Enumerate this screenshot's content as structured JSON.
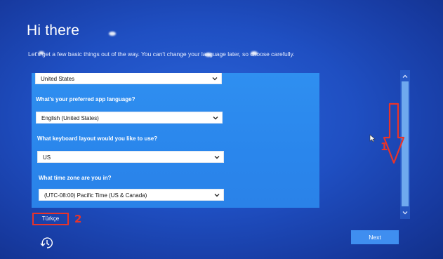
{
  "header": {
    "title": "Hi there",
    "subtitle": "Let's get a few basic things out of the way. You can't change your language later, so choose carefully."
  },
  "form": {
    "country": {
      "value": "United States"
    },
    "app_language": {
      "label": "What's your preferred app language?",
      "value": "English (United States)"
    },
    "keyboard": {
      "label": "What keyboard layout would you like to use?",
      "value": "US"
    },
    "timezone": {
      "label": "What time zone are you in?",
      "value": "(UTC-08:00) Pacific Time (US & Canada)"
    }
  },
  "footer": {
    "language_link": "Türkçe",
    "next_label": "Next"
  },
  "annotations": {
    "label_1": "1",
    "label_2": "2"
  },
  "colors": {
    "background": "#1f4fc2",
    "panel": "#2f8ff0",
    "annotation_red": "#e8342a",
    "next_button": "#3f8ef0"
  },
  "icons": [
    "chevron-down-icon",
    "scroll-up-icon",
    "scroll-down-icon",
    "accessibility-icon",
    "mouse-cursor-icon",
    "down-arrow-annotation"
  ]
}
